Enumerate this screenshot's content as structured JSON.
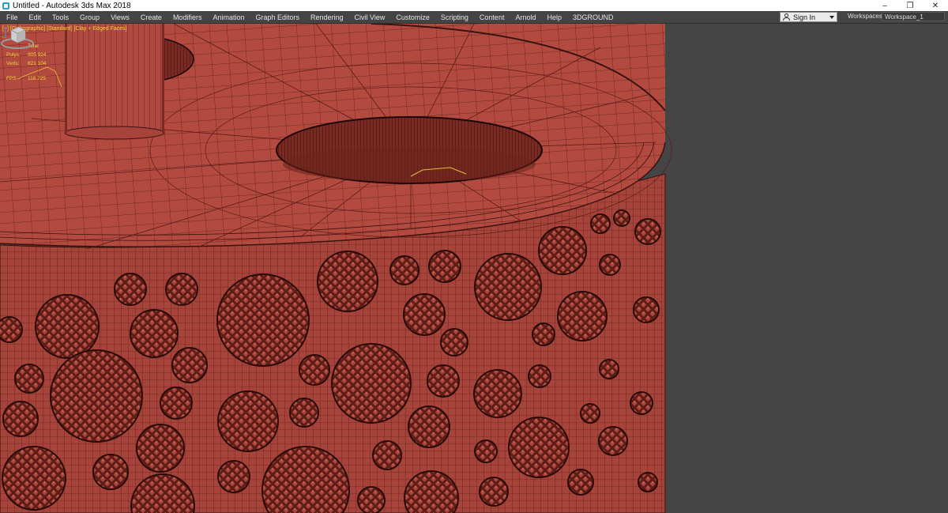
{
  "window": {
    "title": "Untitled - Autodesk 3ds Max 2018",
    "controls": {
      "minimize": "–",
      "restore": "❐",
      "close": "✕"
    }
  },
  "menubar": {
    "items": [
      "File",
      "Edit",
      "Tools",
      "Group",
      "Views",
      "Create",
      "Modifiers",
      "Animation",
      "Graph Editors",
      "Rendering",
      "Civil View",
      "Customize",
      "Scripting",
      "Content",
      "Arnold",
      "Help",
      "3DGROUND"
    ],
    "sign_in": "Sign In",
    "workspaces_label": "Workspaces:",
    "workspace_value": "Workspace_1"
  },
  "viewport": {
    "label": "[+] [Orthographic] [Standard] [Clay + Edged Faces]",
    "stats": {
      "header": "Total",
      "polys_label": "Polys:",
      "polys_value": "905 924",
      "verts_label": "Verts:",
      "verts_value": "821 104",
      "fps_label": "FPS:",
      "fps_value": "118.725"
    },
    "colors": {
      "mesh": "#b24a40",
      "mesh_side": "#9c3d33",
      "wire": "#3a120e",
      "background": "#454545",
      "overlay_text": "#f2d33b"
    },
    "icons": [
      "viewcube-icon",
      "axis-tripod-icon"
    ]
  }
}
